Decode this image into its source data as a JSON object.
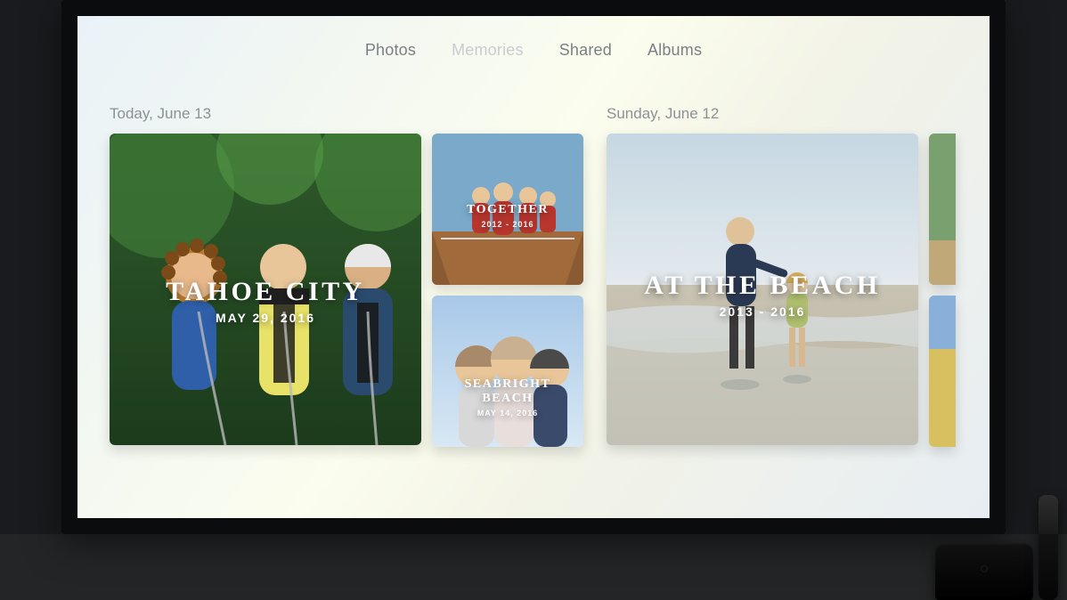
{
  "tabs": [
    {
      "label": "Photos",
      "active": false
    },
    {
      "label": "Memories",
      "active": true
    },
    {
      "label": "Shared",
      "active": false
    },
    {
      "label": "Albums",
      "active": false
    }
  ],
  "sections": [
    {
      "label": "Today, June 13",
      "cards": [
        {
          "title": "TAHOE CITY",
          "sub": "MAY 29, 2016",
          "size": "lg",
          "text_align": "center-mid"
        },
        {
          "title": "TOGETHER",
          "sub": "2012 - 2016",
          "size": "sm",
          "text_align": "center-mid"
        },
        {
          "title": "SEABRIGHT BEACH",
          "sub": "MAY 14, 2016",
          "size": "sm",
          "text_align": "center-low"
        }
      ]
    },
    {
      "label": "Sunday, June 12",
      "cards": [
        {
          "title": "AT THE BEACH",
          "sub": "2013 - 2016",
          "size": "lg",
          "text_align": "center-mid"
        }
      ]
    }
  ]
}
